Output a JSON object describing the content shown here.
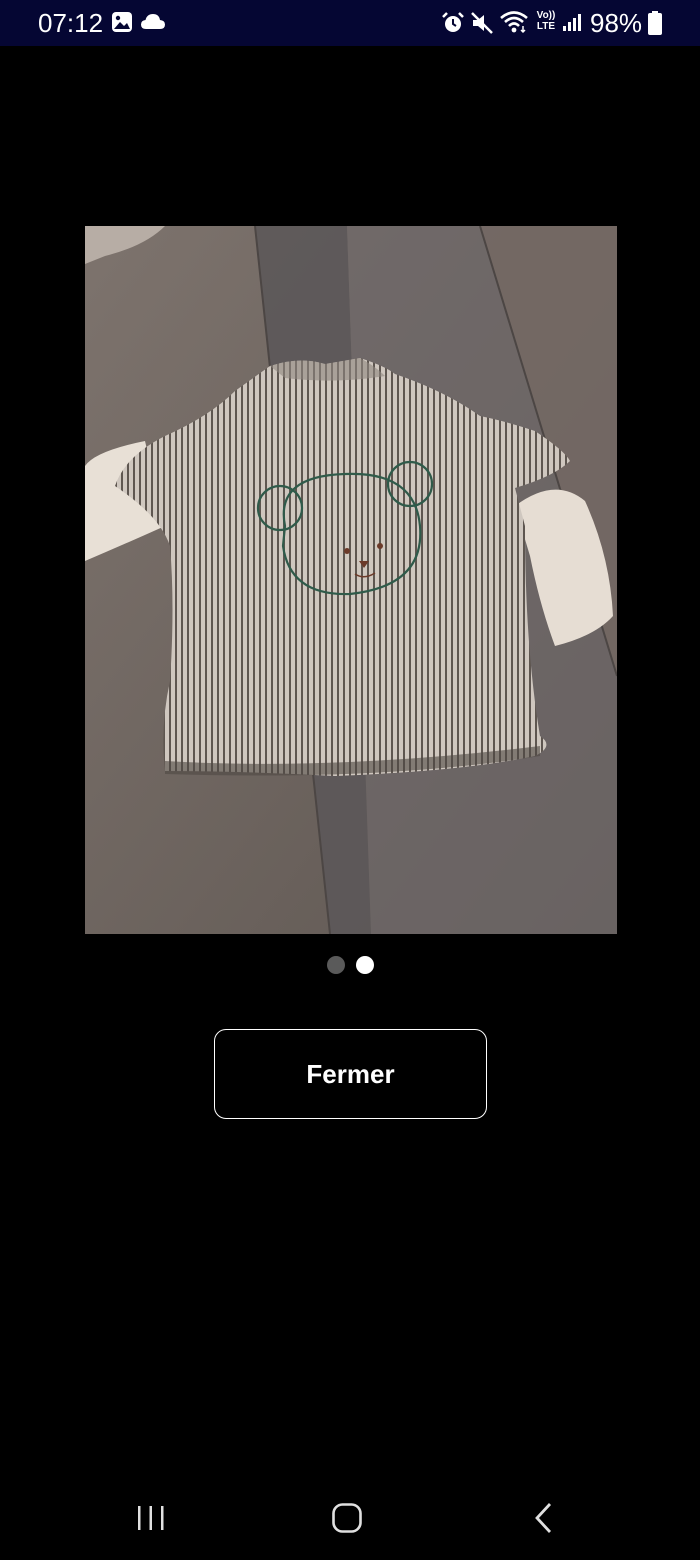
{
  "status_bar": {
    "time": "07:12",
    "battery": "98%",
    "left_icons": [
      "gallery-icon",
      "cloud-icon"
    ],
    "right_icons": [
      "alarm-icon",
      "mute-icon",
      "wifi-icon",
      "volte-icon",
      "signal-icon",
      "battery-icon"
    ],
    "volte_label_top": "Vo))",
    "volte_label_bottom": "LTE"
  },
  "gallery": {
    "image_alt": "Striped baby shirt with embroidered teddy bear on the back",
    "total_pages": 2,
    "current_page": 2,
    "active_dot_color": "#ffffff",
    "inactive_dot_color": "#5a5a5a"
  },
  "close_button": {
    "label": "Fermer"
  },
  "nav_bar": {
    "recents": "recents-icon",
    "home": "home-icon",
    "back": "back-icon"
  },
  "colors": {
    "status_bar_bg": "#050633",
    "background": "#000000",
    "button_border": "#ffffff"
  }
}
